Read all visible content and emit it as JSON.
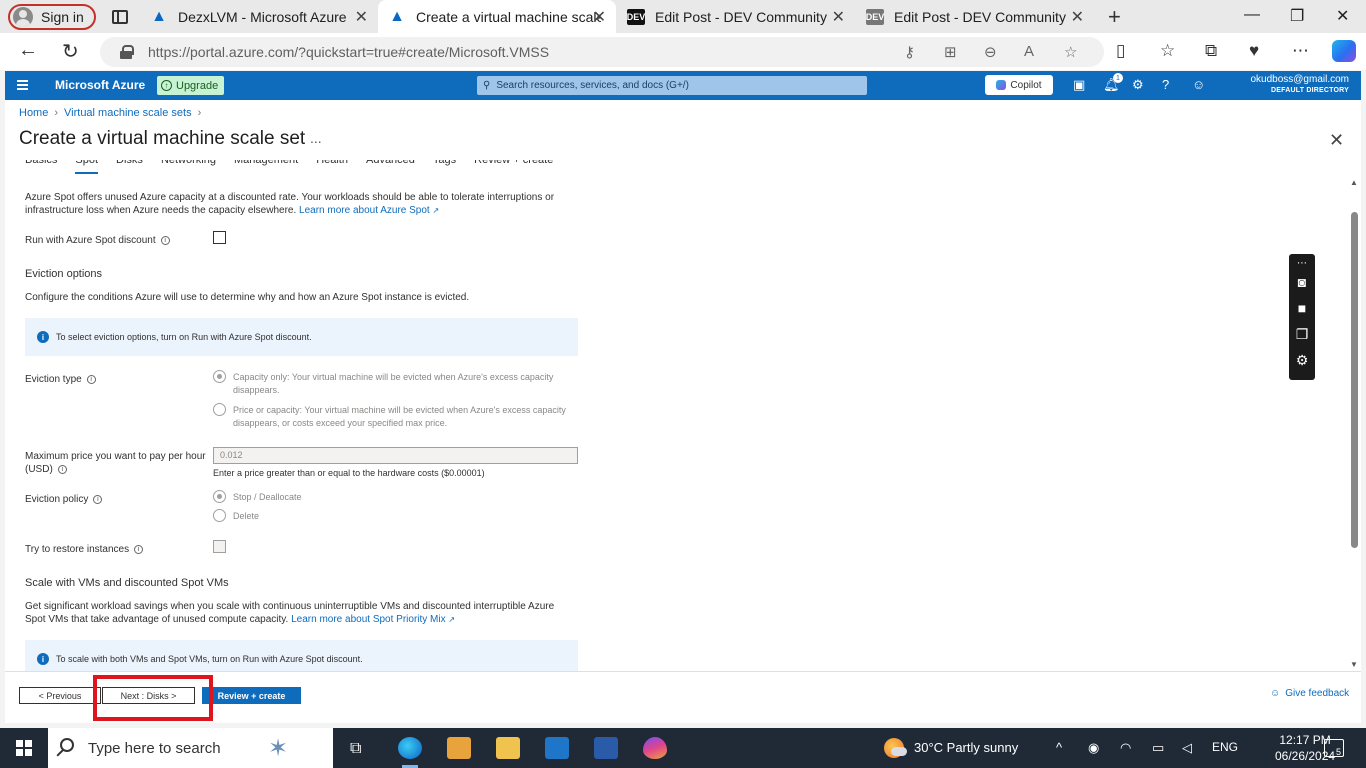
{
  "browser": {
    "profile_label": "Sign in",
    "tabs": [
      {
        "title": "DezxLVM - Microsoft Azure",
        "favicon": "azure-logo"
      },
      {
        "title": "Create a virtual machine scale set",
        "favicon": "azure-logo",
        "active": true
      },
      {
        "title": "Edit Post - DEV Community",
        "favicon": "dev-logo"
      },
      {
        "title": "Edit Post - DEV Community",
        "favicon": "dev-logo"
      }
    ],
    "dev_favicon_text": "DEV",
    "url": "https://portal.azure.com/?quickstart=true#create/Microsoft.VMSS"
  },
  "azure": {
    "brand": "Microsoft Azure",
    "upgrade_label": "Upgrade",
    "search_placeholder": "Search resources, services, and docs (G+/)",
    "copilot_label": "Copilot",
    "notification_count": "1",
    "account_email": "okudboss@gmail.com",
    "account_directory": "DEFAULT DIRECTORY"
  },
  "breadcrumb": [
    "Home",
    "Virtual machine scale sets"
  ],
  "page_title": "Create a virtual machine scale set",
  "title_more": "...",
  "wizard_tabs": [
    "Basics",
    "Spot",
    "Disks",
    "Networking",
    "Management",
    "Health",
    "Advanced",
    "Tags",
    "Review + create"
  ],
  "selected_tab": "Spot",
  "spot": {
    "intro_text": "Azure Spot offers unused Azure capacity at a discounted rate. Your workloads should be able to tolerate interruptions or infrastructure loss when Azure needs the capacity elsewhere.",
    "intro_link": "Learn more about Azure Spot",
    "run_with_spot_label": "Run with Azure Spot discount",
    "eviction_heading": "Eviction options",
    "eviction_desc": "Configure the conditions Azure will use to determine why and how an Azure Spot instance is evicted.",
    "eviction_info": "To select eviction options, turn on Run with Azure Spot discount.",
    "eviction_type_label": "Eviction type",
    "eviction_type_options": [
      "Capacity only: Your virtual machine will be evicted when Azure's excess capacity disappears.",
      "Price or capacity: Your virtual machine will be evicted when Azure's excess capacity disappears, or costs exceed your specified max price."
    ],
    "max_price_label": "Maximum price you want to pay per hour (USD)",
    "max_price_value": "0.012",
    "max_price_hint": "Enter a price greater than or equal to the hardware costs ($0.00001)",
    "eviction_policy_label": "Eviction policy",
    "eviction_policy_options": [
      "Stop / Deallocate",
      "Delete"
    ],
    "restore_label": "Try to restore instances",
    "scale_heading": "Scale with VMs and discounted Spot VMs",
    "scale_desc": "Get significant workload savings when you scale with continuous uninterruptible VMs and discounted interruptible Azure Spot VMs that take advantage of unused compute capacity.",
    "scale_link": "Learn more about Spot Priority Mix",
    "scale_info": "To scale with both VMs and Spot VMs, turn on Run with Azure Spot discount."
  },
  "footer": {
    "previous_label": "< Previous",
    "next_label": "Next : Disks >",
    "review_label": "Review + create",
    "feedback_label": "Give feedback"
  },
  "taskbar": {
    "search_placeholder": "Type here to search",
    "weather": "30°C  Partly sunny",
    "language": "ENG",
    "time": "12:17 PM",
    "date": "06/26/2024",
    "notification_count": "5"
  },
  "colors": {
    "azure_blue": "#0f6cbd",
    "highlight_red": "#e0141e"
  }
}
